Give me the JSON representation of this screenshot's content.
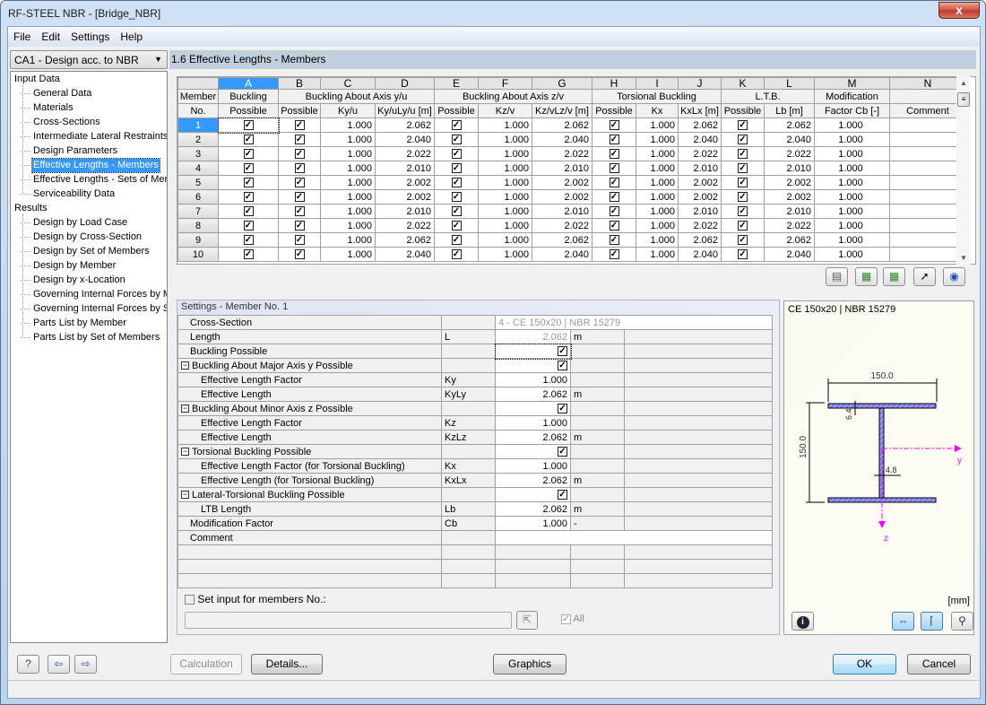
{
  "window": {
    "title": "RF-STEEL NBR - [Bridge_NBR]",
    "close_label": "x"
  },
  "menu": [
    "File",
    "Edit",
    "Settings",
    "Help"
  ],
  "case_combo": {
    "value": "CA1 - Design acc. to NBR"
  },
  "nav": {
    "input_header": "Input Data",
    "input_items": [
      "General Data",
      "Materials",
      "Cross-Sections",
      "Intermediate Lateral Restraints",
      "Design Parameters",
      "Effective Lengths - Members",
      "Effective Lengths - Sets of Members",
      "Serviceability Data"
    ],
    "selected": "Effective Lengths - Members",
    "results_header": "Results",
    "results_items": [
      "Design by Load Case",
      "Design by Cross-Section",
      "Design by Set of Members",
      "Design by Member",
      "Design by x-Location",
      "Governing Internal Forces by Member",
      "Governing Internal Forces by Set of Members",
      "Parts List by Member",
      "Parts List by Set of Members"
    ]
  },
  "section_title": "1.6 Effective Lengths - Members",
  "table": {
    "col_letters": [
      "A",
      "B",
      "C",
      "D",
      "E",
      "F",
      "G",
      "H",
      "I",
      "J",
      "K",
      "L",
      "M",
      "N"
    ],
    "member_hdr": [
      "Member",
      "No."
    ],
    "groups": {
      "buckling": [
        "Buckling",
        "Possible"
      ],
      "axis_y": "Buckling About Axis y/u",
      "axis_z": "Buckling About Axis z/v",
      "torsional": "Torsional Buckling",
      "ltb": "L.T.B.",
      "mod": [
        "Modification",
        "Factor Cb [-]"
      ],
      "comment": "Comment"
    },
    "subheaders": {
      "possible": "Possible",
      "ky": "Ky/u",
      "kyly": "Ky/uLy/u [m]",
      "kz": "Kz/v",
      "kzlz": "Kz/vLz/v [m]",
      "kx": "Kx",
      "kxlx": "KxLx [m]",
      "lb": "Lb [m]"
    },
    "rows": [
      {
        "no": "1",
        "A": true,
        "B": true,
        "C": "1.000",
        "D": "2.062",
        "E": true,
        "F": "1.000",
        "G": "2.062",
        "H": true,
        "I": "1.000",
        "J": "2.062",
        "K": true,
        "L": "2.062",
        "M": "1.000",
        "N": ""
      },
      {
        "no": "2",
        "A": true,
        "B": true,
        "C": "1.000",
        "D": "2.040",
        "E": true,
        "F": "1.000",
        "G": "2.040",
        "H": true,
        "I": "1.000",
        "J": "2.040",
        "K": true,
        "L": "2.040",
        "M": "1.000",
        "N": ""
      },
      {
        "no": "3",
        "A": true,
        "B": true,
        "C": "1.000",
        "D": "2.022",
        "E": true,
        "F": "1.000",
        "G": "2.022",
        "H": true,
        "I": "1.000",
        "J": "2.022",
        "K": true,
        "L": "2.022",
        "M": "1.000",
        "N": ""
      },
      {
        "no": "4",
        "A": true,
        "B": true,
        "C": "1.000",
        "D": "2.010",
        "E": true,
        "F": "1.000",
        "G": "2.010",
        "H": true,
        "I": "1.000",
        "J": "2.010",
        "K": true,
        "L": "2.010",
        "M": "1.000",
        "N": ""
      },
      {
        "no": "5",
        "A": true,
        "B": true,
        "C": "1.000",
        "D": "2.002",
        "E": true,
        "F": "1.000",
        "G": "2.002",
        "H": true,
        "I": "1.000",
        "J": "2.002",
        "K": true,
        "L": "2.002",
        "M": "1.000",
        "N": ""
      },
      {
        "no": "6",
        "A": true,
        "B": true,
        "C": "1.000",
        "D": "2.002",
        "E": true,
        "F": "1.000",
        "G": "2.002",
        "H": true,
        "I": "1.000",
        "J": "2.002",
        "K": true,
        "L": "2.002",
        "M": "1.000",
        "N": ""
      },
      {
        "no": "7",
        "A": true,
        "B": true,
        "C": "1.000",
        "D": "2.010",
        "E": true,
        "F": "1.000",
        "G": "2.010",
        "H": true,
        "I": "1.000",
        "J": "2.010",
        "K": true,
        "L": "2.010",
        "M": "1.000",
        "N": ""
      },
      {
        "no": "8",
        "A": true,
        "B": true,
        "C": "1.000",
        "D": "2.022",
        "E": true,
        "F": "1.000",
        "G": "2.022",
        "H": true,
        "I": "1.000",
        "J": "2.022",
        "K": true,
        "L": "2.022",
        "M": "1.000",
        "N": ""
      },
      {
        "no": "9",
        "A": true,
        "B": true,
        "C": "1.000",
        "D": "2.062",
        "E": true,
        "F": "1.000",
        "G": "2.062",
        "H": true,
        "I": "1.000",
        "J": "2.062",
        "K": true,
        "L": "2.062",
        "M": "1.000",
        "N": ""
      },
      {
        "no": "10",
        "A": true,
        "B": true,
        "C": "1.000",
        "D": "2.040",
        "E": true,
        "F": "1.000",
        "G": "2.040",
        "H": true,
        "I": "1.000",
        "J": "2.040",
        "K": true,
        "L": "2.040",
        "M": "1.000",
        "N": ""
      }
    ],
    "toolbar_icons": [
      "import-icon",
      "excel-export-icon",
      "excel-import-icon",
      "select-member-icon",
      "view-icon"
    ]
  },
  "settings": {
    "title": "Settings - Member No. 1",
    "rows": [
      {
        "label": "Cross-Section",
        "level": 1,
        "symbol": "",
        "value": "4 - CE 150x20 | NBR 15279",
        "unit": "",
        "type": "cs"
      },
      {
        "label": "Length",
        "level": 1,
        "symbol": "L",
        "value": "2.062",
        "unit": "m",
        "type": "gray"
      },
      {
        "label": "Buckling Possible",
        "level": 1,
        "symbol": "",
        "value": "",
        "unit": "",
        "type": "check",
        "focus": true
      },
      {
        "label": "Buckling About Major Axis y Possible",
        "level": 0,
        "symbol": "",
        "value": "",
        "unit": "",
        "type": "check"
      },
      {
        "label": "Effective Length Factor",
        "level": 2,
        "symbol": "Ky",
        "value": "1.000",
        "unit": "",
        "type": "num"
      },
      {
        "label": "Effective Length",
        "level": 2,
        "symbol": "KyLy",
        "value": "2.062",
        "unit": "m",
        "type": "num"
      },
      {
        "label": "Buckling About Minor Axis z Possible",
        "level": 0,
        "symbol": "",
        "value": "",
        "unit": "",
        "type": "check"
      },
      {
        "label": "Effective Length Factor",
        "level": 2,
        "symbol": "Kz",
        "value": "1.000",
        "unit": "",
        "type": "num"
      },
      {
        "label": "Effective Length",
        "level": 2,
        "symbol": "KzLz",
        "value": "2.062",
        "unit": "m",
        "type": "num"
      },
      {
        "label": "Torsional Buckling Possible",
        "level": 0,
        "symbol": "",
        "value": "",
        "unit": "",
        "type": "check"
      },
      {
        "label": "Effective Length Factor (for Torsional Buckling)",
        "level": 2,
        "symbol": "Kx",
        "value": "1.000",
        "unit": "",
        "type": "num"
      },
      {
        "label": "Effective Length (for Torsional Buckling)",
        "level": 2,
        "symbol": "KxLx",
        "value": "2.062",
        "unit": "m",
        "type": "num"
      },
      {
        "label": "Lateral-Torsional Buckling Possible",
        "level": 0,
        "symbol": "",
        "value": "",
        "unit": "",
        "type": "check"
      },
      {
        "label": "LTB Length",
        "level": 2,
        "symbol": "Lb",
        "value": "2.062",
        "unit": "m",
        "type": "num"
      },
      {
        "label": "Modification Factor",
        "level": 1,
        "symbol": "Cb",
        "value": "1.000",
        "unit": "-",
        "type": "num"
      },
      {
        "label": "Comment",
        "level": 1,
        "symbol": "",
        "value": "",
        "unit": "",
        "type": "comment"
      }
    ],
    "set_input_label": "Set input for members No.:",
    "set_input_value": "",
    "all_label": "All"
  },
  "graphic": {
    "title": "CE 150x20 | NBR 15279",
    "dim_width": "150.0",
    "dim_height": "150.0",
    "dim_flange": "6.4",
    "dim_web": "4.8",
    "axis_y": "y",
    "axis_z": "z",
    "unit": "[mm]",
    "accent": "#ff00ff",
    "fill": "#7b7bf0"
  },
  "footer": {
    "calculation": "Calculation",
    "details": "Details...",
    "graphics": "Graphics",
    "ok": "OK",
    "cancel": "Cancel"
  }
}
